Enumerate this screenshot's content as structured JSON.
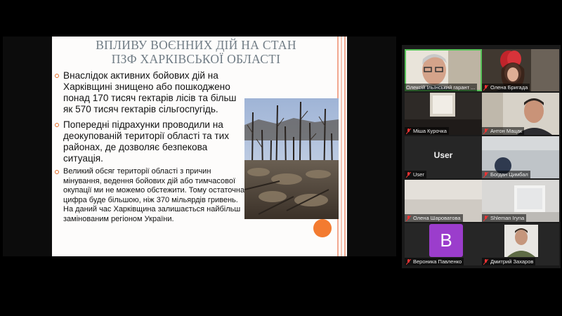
{
  "slide": {
    "title_line1": "ВПЛИВУ ВОЄННИХ ДІЙ НА СТАН",
    "title_line2": "ПЗФ ХАРКІВСЬКОЇ ОБЛАСТІ",
    "bullets": [
      "Внаслідок активних бойових дій на Харківщині знищено або пошкоджено понад 170 тисяч гектарів лісів та більш як 570 тисяч гектарів сільгоспугідь.",
      "Попередні підрахунки проводили на деокупованій території області та тих районах, де дозволяє безпекова ситуація.",
      "Великий обсяг території області з причин мінування, ведення бойових дій або тимчасової окупації ми не можемо обстежити. Тому остаточна цифра буде більшою, ніж 370 мільярдів гривень. На даний час Харківщина залишається найбільш замінованим регіоном України."
    ],
    "accent_color": "#f37b30"
  },
  "participants": [
    {
      "name": "Олексій Ільїнський гарант ...",
      "muted": false,
      "active": true
    },
    {
      "name": "Олена Бригада",
      "muted": true
    },
    {
      "name": "Міша Курочка",
      "muted": true
    },
    {
      "name": "Антон Мацак",
      "muted": true
    },
    {
      "name": "User",
      "muted": true,
      "label": "User"
    },
    {
      "name": "Богдан Цимбал",
      "muted": true
    },
    {
      "name": "Олена Шароватова",
      "muted": true
    },
    {
      "name": "Shleman Iryna",
      "muted": true
    },
    {
      "name": "Вероника Павленко",
      "muted": true,
      "avatar_letter": "B",
      "avatar_color": "#9b3dcc"
    },
    {
      "name": "Дмитрий Захаров",
      "muted": true
    }
  ]
}
